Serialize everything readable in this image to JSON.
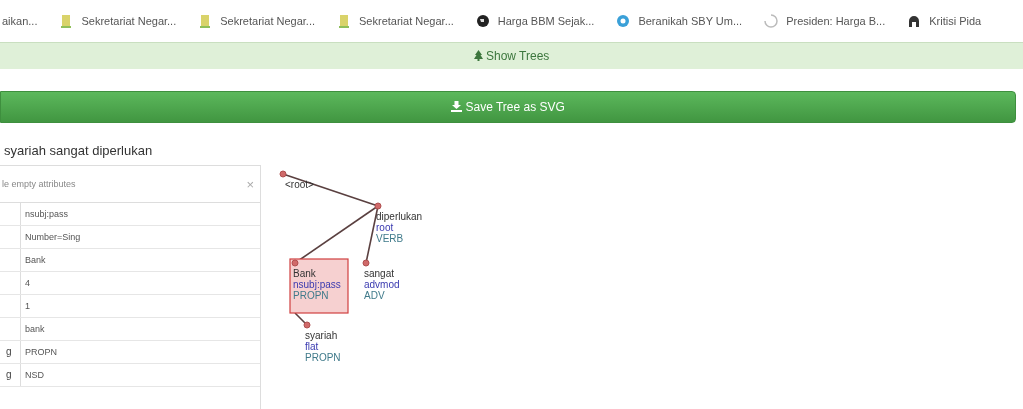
{
  "bookmarks": [
    {
      "title": "aikan...",
      "kind": "none"
    },
    {
      "title": "Sekretariat Negar...",
      "kind": "doc"
    },
    {
      "title": "Sekretariat Negar...",
      "kind": "doc"
    },
    {
      "title": "Sekretariat Negar...",
      "kind": "doc"
    },
    {
      "title": "Harga BBM Sejak...",
      "kind": "globe"
    },
    {
      "title": "Beranikah SBY Um...",
      "kind": "badge"
    },
    {
      "title": "Presiden: Harga B...",
      "kind": "spinner"
    },
    {
      "title": "Kritisi Pida",
      "kind": "figure"
    }
  ],
  "show_trees_button": "Show Trees",
  "save_button": "Save Tree as SVG",
  "sentence": "syariah sangat diperlukan",
  "attributes": {
    "filter_placeholder": "le empty attributes",
    "clear_icon": "×",
    "rows": [
      {
        "value": "nsubj:pass"
      },
      {
        "value": "Number=Sing"
      },
      {
        "value": "Bank"
      },
      {
        "value": "4"
      },
      {
        "value": "1"
      },
      {
        "value": "bank"
      },
      {
        "key": "g",
        "value": "PROPN"
      },
      {
        "key": "g",
        "value": "NSD"
      }
    ]
  },
  "tree": {
    "label": "<root>",
    "children": [
      {
        "form": "diperlukan",
        "deprel": "root",
        "upos": "VERB",
        "selected": false,
        "children": [
          {
            "form": "Bank",
            "deprel": "nsubj:pass",
            "upos": "PROPN",
            "selected": true,
            "children": [
              {
                "form": "syariah",
                "deprel": "flat",
                "upos": "PROPN",
                "selected": false
              }
            ]
          },
          {
            "form": "sangat",
            "deprel": "advmod",
            "upos": "ADV",
            "selected": false
          }
        ]
      }
    ]
  }
}
